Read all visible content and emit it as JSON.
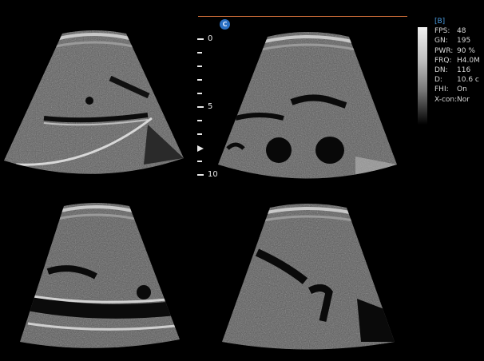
{
  "quad_view": {
    "panels": [
      {
        "name": "upper-left-scan"
      },
      {
        "name": "upper-right-scan"
      },
      {
        "name": "lower-left-scan"
      },
      {
        "name": "lower-right-scan"
      }
    ],
    "active_marker_label": "C"
  },
  "depth_scale": {
    "labels": [
      "0",
      "5",
      "10"
    ],
    "unit_ticks": 11
  },
  "parameters": {
    "title": "[B]",
    "rows": [
      {
        "key": "FPS:",
        "value": "48"
      },
      {
        "key": "GN:",
        "value": "195"
      },
      {
        "key": "PWR:",
        "value": "90 %"
      },
      {
        "key": "FRQ:",
        "value": "H4.0M"
      },
      {
        "key": "DN:",
        "value": "116"
      },
      {
        "key": "D:",
        "value": "10.6 c"
      },
      {
        "key": "FHI:",
        "value": "On"
      },
      {
        "key": "X-con:",
        "value": "Nor"
      }
    ]
  },
  "colors": {
    "background": "#000000",
    "orange_line": "#d9733b",
    "marker_blue": "#2a6fc1",
    "title_blue": "#4a9ce0"
  }
}
